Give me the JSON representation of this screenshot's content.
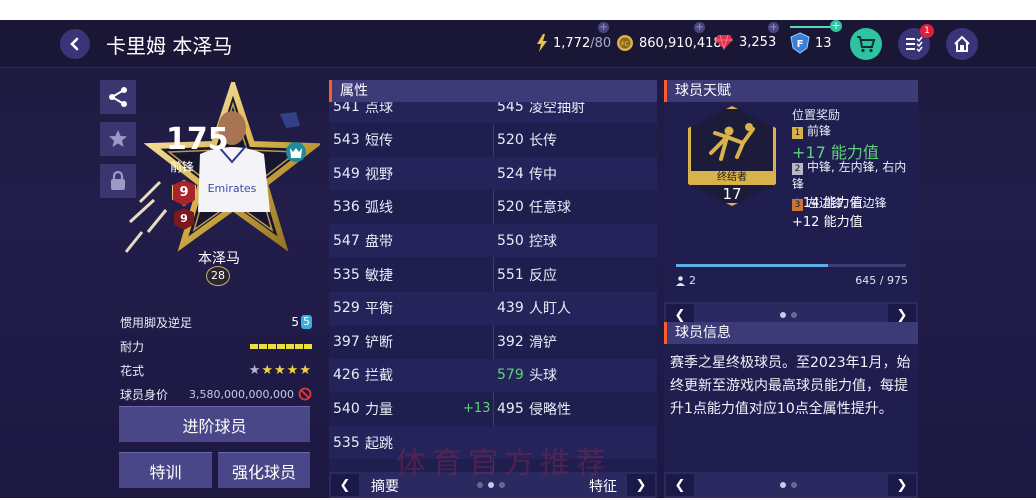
{
  "header": {
    "title": "卡里姆 本泽马",
    "stamina": "1,772",
    "stamina_max": "/80",
    "coins": "860,910,418",
    "gems": "3,253",
    "fc_level": "13",
    "notification_count": "1"
  },
  "card": {
    "rating": "175",
    "position": "前锋",
    "name": "本泽马",
    "number": "28",
    "rank1": "9",
    "rank2": "9"
  },
  "player_attrs": {
    "foot_label": "惯用脚及逆足",
    "foot_values": [
      "5",
      "5"
    ],
    "stamina_label": "耐力",
    "skill_label": "花式",
    "skill_stars": 5,
    "value_label": "球员身价",
    "value": "3,580,000,000,000"
  },
  "buttons": {
    "advance": "进阶球员",
    "training": "特训",
    "enhance": "强化球员"
  },
  "stats_panel": {
    "title": "属性",
    "rows": [
      {
        "l_num": "541",
        "l_name": "点球",
        "r_num": "545",
        "r_name": "凌空抽射"
      },
      {
        "l_num": "543",
        "l_name": "短传",
        "r_num": "520",
        "r_name": "长传"
      },
      {
        "l_num": "549",
        "l_name": "视野",
        "r_num": "524",
        "r_name": "传中"
      },
      {
        "l_num": "536",
        "l_name": "弧线",
        "r_num": "520",
        "r_name": "任意球"
      },
      {
        "l_num": "547",
        "l_name": "盘带",
        "r_num": "550",
        "r_name": "控球"
      },
      {
        "l_num": "535",
        "l_name": "敏捷",
        "r_num": "551",
        "r_name": "反应"
      },
      {
        "l_num": "529",
        "l_name": "平衡",
        "r_num": "439",
        "r_name": "人盯人"
      },
      {
        "l_num": "397",
        "l_name": "铲断",
        "r_num": "392",
        "r_name": "滑铲"
      },
      {
        "l_num": "426",
        "l_name": "拦截",
        "r_num": "579",
        "r_name": "头球"
      },
      {
        "l_num": "540",
        "l_name": "力量",
        "boost": "+13",
        "r_num": "495",
        "r_name": "侵略性"
      },
      {
        "l_num": "535",
        "l_name": "起跳",
        "r_num": "",
        "r_name": ""
      }
    ],
    "nav_left": "摘要",
    "nav_right": "特征"
  },
  "talent_panel": {
    "title": "球员天赋",
    "badge_label": "终结者",
    "badge_level": "17",
    "bonus_title": "位置奖励",
    "bonuses": [
      {
        "rank": "1",
        "positions": "前锋",
        "value": "+17 能力值"
      },
      {
        "rank": "2",
        "positions": "中锋, 左内锋, 右内锋",
        "value": "+14 能力值"
      },
      {
        "rank": "3",
        "positions": "左边锋, 右边锋",
        "value": "+12 能力值"
      }
    ],
    "owned": "2",
    "progress_text": "645 / 975",
    "progress": 0.66
  },
  "info_panel": {
    "title": "球员信息",
    "text": "赛季之星终极球员。至2023年1月，始终更新至游戏内最高球员能力值，每提升1点能力值对应10点全属性提升。"
  },
  "watermark": "体育官方推荐",
  "colors": {
    "accent_orange": "#ff5a2a",
    "gold": "#d8b24a",
    "green": "#5ed17a",
    "cart": "#2ec4a0"
  }
}
